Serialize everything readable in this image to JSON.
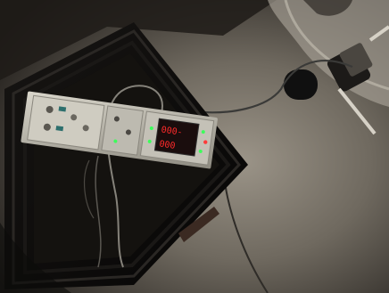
{
  "scene": {
    "description_tag": "photo",
    "colors": {
      "floor_dark": "#2b2723",
      "floor_light": "#8a8478",
      "case_black": "#0e0d0c",
      "panel_metal": "#b9b6ab",
      "display_red": "#ff2a2a",
      "led_green": "#3cff5a"
    }
  },
  "display": {
    "top_readout": "000-",
    "bottom_readout": "000"
  }
}
